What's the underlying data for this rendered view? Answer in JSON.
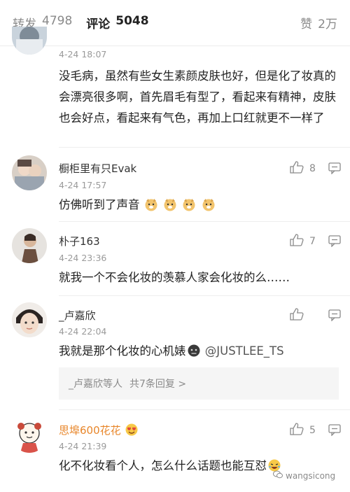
{
  "tabs": {
    "reposts_label": "转发",
    "reposts_count": "4798",
    "comments_label": "评论",
    "comments_count": "5048",
    "likes_label": "赞",
    "likes_count": "2万"
  },
  "comments": [
    {
      "time": "4-24 18:07",
      "text": "没毛病，虽然有些女生素颜皮肤也好，但是化了妆真的会漂亮很多啊，首先眉毛有型了，看起来有精神，皮肤也会好点，看起来有气色，再加上口红就更不一样了"
    },
    {
      "username": "橱柜里有只Evak",
      "time": "4-24 17:57",
      "text": "仿佛听到了声音",
      "likes": "8"
    },
    {
      "username": "朴子163",
      "time": "4-24 23:36",
      "text": "就我一个不会化妆的羡慕人家会化妆的么……",
      "likes": "7"
    },
    {
      "username": "_卢嘉欣",
      "time": "4-24 22:04",
      "text": "我就是那个化妆的心机婊",
      "mention": "@JUSTLEE_TS",
      "reply_summary": "_卢嘉欣等人",
      "reply_count": "共7条回复 >"
    },
    {
      "username": "思埠600花花",
      "time": "4-24 21:39",
      "text": "化不化妆看个人，怎么什么话题也能互怼",
      "likes": "5"
    }
  ],
  "watermark": "wangsicong",
  "colors": {
    "username_highlight": "#e8862a",
    "muted": "#8a8a8a"
  }
}
